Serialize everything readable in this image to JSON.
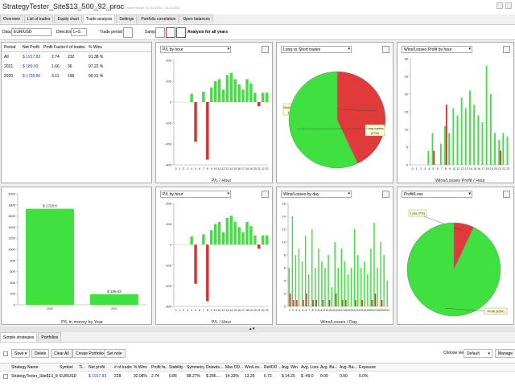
{
  "window": {
    "title": "StrategyTester_Site$13_500_92_proc",
    "subtitle": "Loaded: 31.08.2021  Dataset: M15  Date Range: 02.01.2020 - 30.04.2021"
  },
  "tabs": [
    {
      "label": "Overview"
    },
    {
      "label": "List of trades"
    },
    {
      "label": "Equity chart"
    },
    {
      "label": "Trade analysis"
    },
    {
      "label": "Settings"
    },
    {
      "label": "Portfolio correlation"
    },
    {
      "label": "Open balances"
    }
  ],
  "toolbar": {
    "data_label": "Data",
    "data_value": "EUR/USD",
    "direction_label": "Direction",
    "direction_value": "L+S",
    "trade_period_label": "Trade period by",
    "sample_label": "Sample",
    "analysis_label": "Analysis for all years"
  },
  "period_table": {
    "headers": [
      "Period",
      "Net Profit",
      "Profit Factor",
      "# of trades",
      "% Wins"
    ],
    "rows": [
      [
        "All",
        "$ 1917.83",
        "2.74",
        "232",
        "91.38 %"
      ],
      [
        "2021",
        "$ 189.03",
        "1.66",
        "36",
        "97.22 %"
      ],
      [
        "2020",
        "$ 1728.80",
        "3.11",
        "196",
        "90.31 %"
      ]
    ]
  },
  "charts": {
    "pl_hour_top": {
      "dropdown": "P/L by hour",
      "chart_data": {
        "type": "bar",
        "xlabel": "P/L / Hour",
        "ylim": [
          -300,
          200
        ],
        "yticks": [
          200,
          100,
          0,
          -100,
          -200,
          -300
        ],
        "categories": [
          "0",
          "1",
          "2",
          "3",
          "4",
          "5",
          "6",
          "7",
          "8",
          "9",
          "10",
          "11",
          "12",
          "13",
          "14",
          "15",
          "16",
          "17",
          "18",
          "19",
          "20",
          "21",
          "22",
          "23"
        ],
        "values": [
          0,
          0,
          0,
          0,
          40,
          -190,
          0,
          50,
          -275,
          70,
          100,
          110,
          60,
          130,
          140,
          110,
          85,
          60,
          110,
          90,
          45,
          -20,
          45,
          45
        ],
        "colors": {
          "positive": "#3fe03f",
          "negative": "#d33333"
        }
      }
    },
    "long_short": {
      "dropdown": "Long vs Short trades",
      "chart_data": {
        "type": "pie",
        "labels": [
          "Short trades (43%)",
          "Long trades (57%)"
        ],
        "values": [
          43,
          57
        ],
        "colors": [
          "#e03a3a",
          "#3fe03f"
        ]
      }
    },
    "wins_losses_hour": {
      "dropdown": "Wins/Losses Profit by hour",
      "chart_data": {
        "type": "bar",
        "xlabel": "Wins/Losses Profit / Hour",
        "ylim": [
          0,
          30
        ],
        "yticks": [
          30,
          25,
          20,
          15,
          10,
          5,
          0
        ],
        "categories": [
          "0",
          "1",
          "2",
          "3",
          "4",
          "5",
          "6",
          "7",
          "8",
          "9",
          "10",
          "11",
          "12",
          "13",
          "14",
          "15",
          "16",
          "17",
          "18",
          "19",
          "20",
          "21",
          "22",
          "23"
        ],
        "series": [
          {
            "name": "Wins",
            "color": "#3fe03f",
            "values": [
              0,
              0,
              0,
              0,
              4,
              9,
              0,
              6,
              11,
              9,
              16,
              14,
              19,
              16,
              21,
              17,
              14,
              12,
              28,
              20,
              9,
              7,
              9,
              8
            ]
          },
          {
            "name": "Losses",
            "color": "#d33333",
            "values": [
              0,
              0,
              0,
              0,
              0,
              4,
              0,
              0,
              17,
              0,
              0,
              0,
              0,
              0,
              0,
              0,
              0,
              0,
              0,
              0,
              0,
              4,
              0,
              0
            ]
          }
        ]
      }
    },
    "pl_year": {
      "chart_data": {
        "type": "bar",
        "xlabel": "P/L in money by Year",
        "ylim": [
          0,
          2000
        ],
        "yticks": [
          2000,
          1800,
          1600,
          1400,
          1200,
          1000,
          800,
          600,
          400,
          200,
          0
        ],
        "categories": [
          "2020",
          "2021"
        ],
        "values": [
          1728.8,
          189.03
        ],
        "data_labels": [
          "$ 1728.8",
          "$ 189.03"
        ],
        "color": "#3fe03f"
      }
    },
    "pl_hour_bottom": {
      "dropdown": "P/L by hour",
      "chart_data": {
        "type": "bar",
        "xlabel": "P/L / Hour",
        "ylim": [
          -300,
          200
        ],
        "yticks": [
          200,
          100,
          0,
          -100,
          -200,
          -300
        ],
        "categories": [
          "0",
          "1",
          "2",
          "3",
          "4",
          "5",
          "6",
          "7",
          "8",
          "9",
          "10",
          "11",
          "12",
          "13",
          "14",
          "15",
          "16",
          "17",
          "18",
          "19",
          "20",
          "21",
          "22",
          "23"
        ],
        "values": [
          0,
          0,
          0,
          0,
          40,
          -190,
          0,
          50,
          -275,
          70,
          100,
          110,
          60,
          130,
          140,
          110,
          85,
          60,
          110,
          90,
          45,
          -20,
          45,
          45
        ],
        "colors": {
          "positive": "#3fe03f",
          "negative": "#d33333"
        }
      }
    },
    "wins_losses_day": {
      "dropdown": "Wins/Losses by day",
      "chart_data": {
        "type": "bar",
        "xlabel": "Wins/Losses / Day",
        "ylim": [
          0,
          16
        ],
        "yticks": [
          16,
          14,
          12,
          10,
          8,
          6,
          4,
          2,
          0
        ],
        "categories": [
          "1",
          "2",
          "3",
          "4",
          "5",
          "6",
          "7",
          "8",
          "9",
          "10",
          "11",
          "12",
          "13",
          "14",
          "15",
          "16",
          "17",
          "18",
          "19",
          "20",
          "21",
          "22",
          "23",
          "24",
          "25",
          "26",
          "27",
          "28",
          "29",
          "30",
          "31"
        ],
        "series": [
          {
            "name": "Wins",
            "color": "#3fe03f",
            "values": [
              6,
              14,
              8,
              9,
              7,
              11,
              5,
              12,
              6,
              9,
              7,
              6,
              8,
              3,
              10,
              6,
              9,
              7,
              5,
              6,
              12,
              8,
              6,
              7,
              5,
              9,
              13,
              6,
              10,
              8,
              4
            ]
          },
          {
            "name": "Losses",
            "color": "#d33333",
            "values": [
              2,
              1,
              1,
              0,
              1,
              2,
              0,
              1,
              1,
              0,
              1,
              0,
              1,
              0,
              2,
              0,
              1,
              1,
              0,
              0,
              1,
              0,
              1,
              0,
              0,
              1,
              2,
              0,
              1,
              0,
              0
            ]
          }
        ]
      }
    },
    "profit_loss": {
      "dropdown": "Profit/Loss",
      "chart_data": {
        "type": "pie",
        "labels": [
          "Loss (7%)",
          "Profit (93%)"
        ],
        "values": [
          7,
          93
        ],
        "colors": [
          "#e03a3a",
          "#3fe03f"
        ]
      }
    }
  },
  "bottom": {
    "tabs": [
      {
        "label": "Simple strategies"
      },
      {
        "label": "Portfolios"
      }
    ],
    "buttons": {
      "save": "Save",
      "delete": "Delete",
      "clear_all": "Clear All",
      "create_portfolio": "Create Portfolio",
      "set_note": "Set note"
    },
    "choose_view_label": "Choose view:",
    "choose_view_value": "Default",
    "manage": "Manage"
  },
  "results_table": {
    "headers": [
      "Strategy Name",
      "Symbol",
      "Ti...",
      "Net profit",
      "# of trades",
      "% Wins",
      "Profit fa...",
      "Stability",
      "Symmetry",
      "Drawdo...",
      "Max DD...",
      "Win/Los...",
      "Ret/DD ...",
      "Avg. Win",
      "Avg. Loss",
      "Avg. Ba...",
      "Avg. Ba...",
      "Exposure"
    ],
    "rows": [
      [
        "StrategyTester_Site$13_500...",
        "EURUSD",
        "",
        "$ 1917.83",
        "228",
        "92.98%",
        "2.74",
        "0.86",
        "88.27%",
        "$ 286....",
        "14.33%",
        "13.26",
        "6.72",
        "$ 14.25",
        "$ -49.0",
        "0.00",
        "0.00",
        "0.0%"
      ]
    ]
  }
}
